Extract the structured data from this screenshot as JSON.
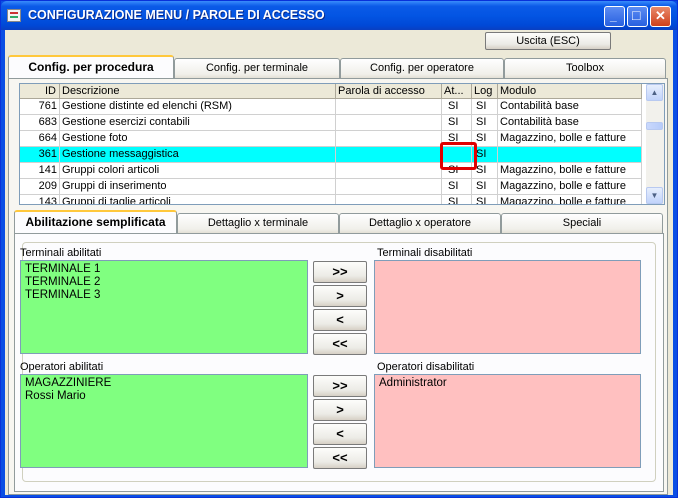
{
  "window": {
    "title": "CONFIGURAZIONE MENU / PAROLE DI ACCESSO",
    "minimize_glyph": "_",
    "maximize_glyph": "□",
    "close_glyph": "✕"
  },
  "exit_button": "Uscita (ESC)",
  "top_tabs": [
    {
      "label": "Config. per procedura",
      "active": true
    },
    {
      "label": "Config. per terminale",
      "active": false
    },
    {
      "label": "Config. per operatore",
      "active": false
    },
    {
      "label": "Toolbox",
      "active": false
    }
  ],
  "grid": {
    "columns": [
      "ID",
      "Descrizione",
      "Parola di accesso",
      "At...",
      "Log",
      "Modulo"
    ],
    "rows": [
      {
        "id": "761",
        "descr": "Gestione distinte ed elenchi (RSM)",
        "pwd": "",
        "at": "SI",
        "log": "SI",
        "modulo": "Contabilità base"
      },
      {
        "id": "683",
        "descr": "Gestione esercizi contabili",
        "pwd": "",
        "at": "SI",
        "log": "SI",
        "modulo": "Contabilità base"
      },
      {
        "id": "664",
        "descr": "Gestione foto",
        "pwd": "",
        "at": "SI",
        "log": "SI",
        "modulo": "Magazzino, bolle e fatture"
      },
      {
        "id": "361",
        "descr": "Gestione messaggistica",
        "pwd": "",
        "at": "",
        "log": "SI",
        "modulo": ""
      },
      {
        "id": "141",
        "descr": "Gruppi colori articoli",
        "pwd": "",
        "at": "SI",
        "log": "SI",
        "modulo": "Magazzino, bolle e fatture"
      },
      {
        "id": "209",
        "descr": "Gruppi di inserimento",
        "pwd": "",
        "at": "SI",
        "log": "SI",
        "modulo": "Magazzino, bolle e fatture"
      },
      {
        "id": "143",
        "descr": "Gruppi di taglie articoli",
        "pwd": "",
        "at": "SI",
        "log": "SI",
        "modulo": "Magazzino, bolle e fatture"
      }
    ],
    "selected_index": 3,
    "scroll_up_glyph": "▲",
    "scroll_down_glyph": "▼"
  },
  "bottom_tabs": [
    {
      "label": "Abilitazione semplificata",
      "active": true
    },
    {
      "label": "Dettaglio x terminale",
      "active": false
    },
    {
      "label": "Dettaglio x operatore",
      "active": false
    },
    {
      "label": "Speciali",
      "active": false
    }
  ],
  "terminals": {
    "enabled_label": "Terminali abilitati",
    "disabled_label": "Terminali disabilitati",
    "enabled": [
      "TERMINALE 1",
      "TERMINALE 2",
      "TERMINALE 3"
    ],
    "disabled": []
  },
  "operators": {
    "enabled_label": "Operatori abilitati",
    "disabled_label": "Operatori disabilitati",
    "enabled": [
      "MAGAZZINIERE",
      "Rossi Mario"
    ],
    "disabled": [
      "Administrator"
    ]
  },
  "move_buttons": {
    "all_right": ">>",
    "right": ">",
    "left": "<",
    "all_left": "<<"
  },
  "colors": {
    "enabled_list": "#80ff80",
    "disabled_list": "#ffc0c0",
    "selected_row": "#00ffff",
    "highlight": "#e00000"
  }
}
